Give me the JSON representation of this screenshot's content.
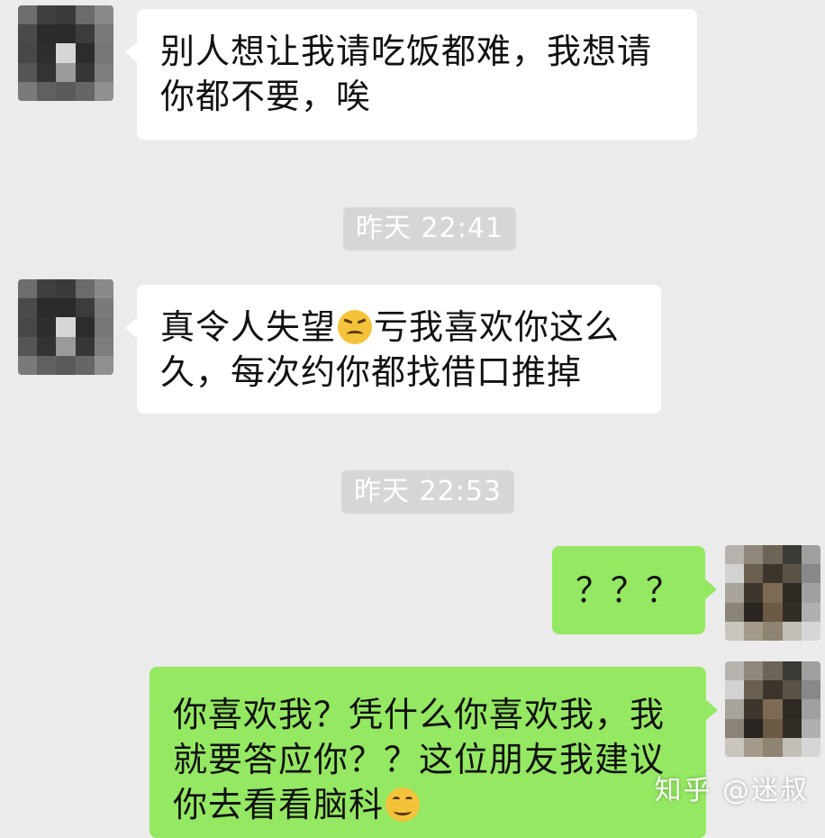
{
  "messages": [
    {
      "side": "in",
      "lines": [
        "别人想让我请吃饭都难，我想请",
        "你都不要，唉"
      ]
    },
    {
      "side": "in",
      "line1_a": "真令人失望",
      "line1_emoji": "annoyed-face-icon",
      "line1_b": "亏我喜欢你这么",
      "line2": "久，每次约你都找借口推掉"
    },
    {
      "side": "out",
      "text": "？？？"
    },
    {
      "side": "out",
      "lines": [
        "你喜欢我？凭什么你喜欢我，我",
        "就要答应你？？这位朋友我建议"
      ],
      "line3": "你去看看脑科",
      "line3_emoji": "smile-face-icon"
    }
  ],
  "timestamps": [
    "昨天 22:41",
    "昨天 22:53"
  ],
  "watermark": "知乎 @迷叔",
  "colors": {
    "background": "#ebebeb",
    "incoming_bubble": "#ffffff",
    "outgoing_bubble": "#94e862",
    "timestamp_bg": "#d6d6d6"
  }
}
